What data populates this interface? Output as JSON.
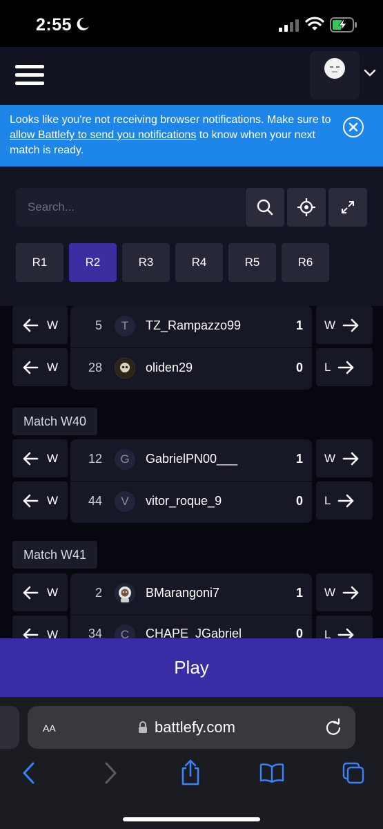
{
  "status_bar": {
    "time": "2:55"
  },
  "banner": {
    "text_before": "Looks like you're not receiving browser notifications. Make sure to ",
    "link": "allow Battlefy to send you notifications",
    "text_after": " to know when your next match is ready."
  },
  "search": {
    "placeholder": "Search..."
  },
  "rounds": [
    "R1",
    "R2",
    "R3",
    "R4",
    "R5",
    "R6"
  ],
  "active_round": "R2",
  "matches": [
    {
      "label": "",
      "players": [
        {
          "seed": "5",
          "initial": "T",
          "name": "TZ_Rampazzo99",
          "score": "1",
          "left_nav": "W",
          "right_nav": "W"
        },
        {
          "seed": "28",
          "initial": "",
          "name": "oliden29",
          "score": "0",
          "left_nav": "W",
          "right_nav": "L"
        }
      ]
    },
    {
      "label": "Match W40",
      "players": [
        {
          "seed": "12",
          "initial": "G",
          "name": "GabrielPN00___",
          "score": "1",
          "left_nav": "W",
          "right_nav": "W"
        },
        {
          "seed": "44",
          "initial": "V",
          "name": "vitor_roque_9",
          "score": "0",
          "left_nav": "W",
          "right_nav": "L"
        }
      ]
    },
    {
      "label": "Match W41",
      "players": [
        {
          "seed": "2",
          "initial": "",
          "name": "BMarangoni7",
          "score": "1",
          "left_nav": "W",
          "right_nav": "W"
        },
        {
          "seed": "34",
          "initial": "C",
          "name": "CHAPE_JGabriel",
          "score": "0",
          "left_nav": "W",
          "right_nav": "L"
        }
      ]
    }
  ],
  "play_button": "Play",
  "safari": {
    "aa": "AA",
    "url": "battlefy.com"
  },
  "colors": {
    "accent": "#392da5",
    "banner": "#1e86e8",
    "active_round": "#3a2ea0",
    "ios_blue": "#3a82f7"
  }
}
